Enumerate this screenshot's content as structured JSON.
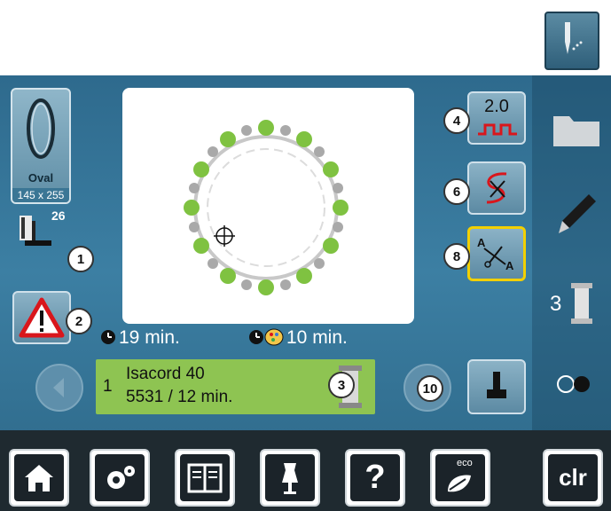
{
  "hoop": {
    "name": "Oval",
    "size": "145 x 255"
  },
  "presser_foot": {
    "number": "26"
  },
  "badges": {
    "b1": "1",
    "b2": "2",
    "b3": "3",
    "b4": "4",
    "b6": "6",
    "b8": "8",
    "b10": "10"
  },
  "stitch_length": {
    "value": "2.0"
  },
  "times": {
    "total": "19 min.",
    "color_change": "10 min."
  },
  "thread": {
    "index": "1",
    "name": "Isacord 40",
    "detail": "5531 / 12 min."
  },
  "right_column": {
    "color_count": "3"
  },
  "bottom_bar": {
    "clr_label": "clr",
    "help_label": "?",
    "eco_label": "eco"
  },
  "colors": {
    "accent_green": "#8ec452",
    "yellow_highlight": "#f2d000",
    "warning_red": "#d9161c",
    "background_blue": "#3c7fa3"
  }
}
